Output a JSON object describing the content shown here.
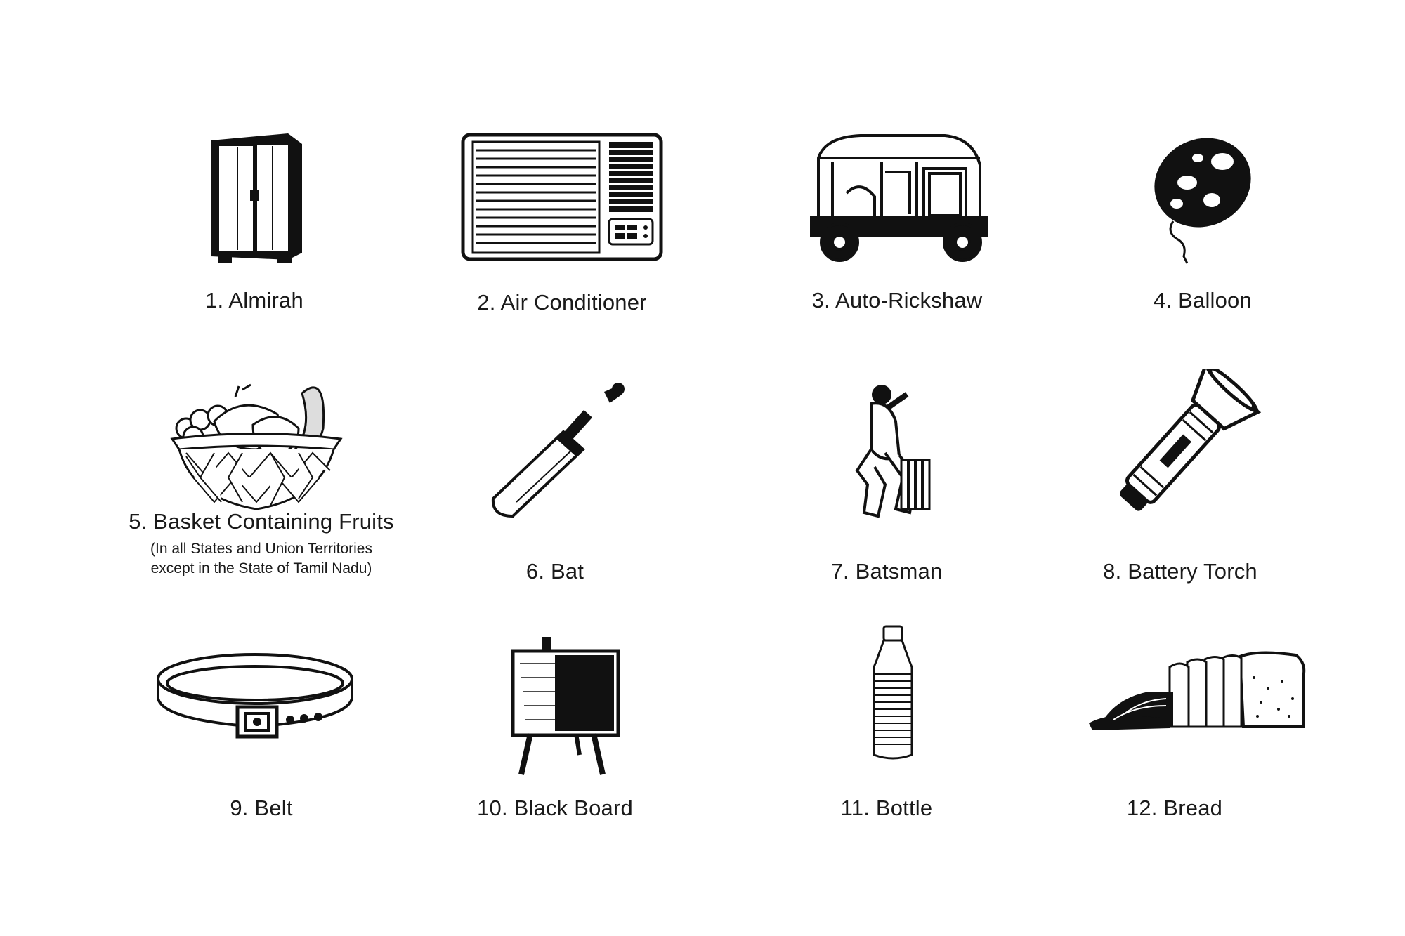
{
  "symbols": [
    {
      "label": "1. Almirah",
      "icon": "almirah-icon"
    },
    {
      "label": "2. Air Conditioner",
      "icon": "air-conditioner-icon"
    },
    {
      "label": "3. Auto-Rickshaw",
      "icon": "auto-rickshaw-icon"
    },
    {
      "label": "4. Balloon",
      "icon": "balloon-icon"
    },
    {
      "label": "5. Basket Containing Fruits",
      "icon": "fruit-basket-icon",
      "note_line1": "(In all States and Union Territories",
      "note_line2": "except in the State of Tamil Nadu)"
    },
    {
      "label": "6. Bat",
      "icon": "cricket-bat-icon"
    },
    {
      "label": "7. Batsman",
      "icon": "batsman-icon"
    },
    {
      "label": "8. Battery Torch",
      "icon": "battery-torch-icon"
    },
    {
      "label": "9. Belt",
      "icon": "belt-icon"
    },
    {
      "label": "10. Black Board",
      "icon": "black-board-icon"
    },
    {
      "label": "11. Bottle",
      "icon": "bottle-icon"
    },
    {
      "label": "12. Bread",
      "icon": "bread-icon"
    }
  ]
}
